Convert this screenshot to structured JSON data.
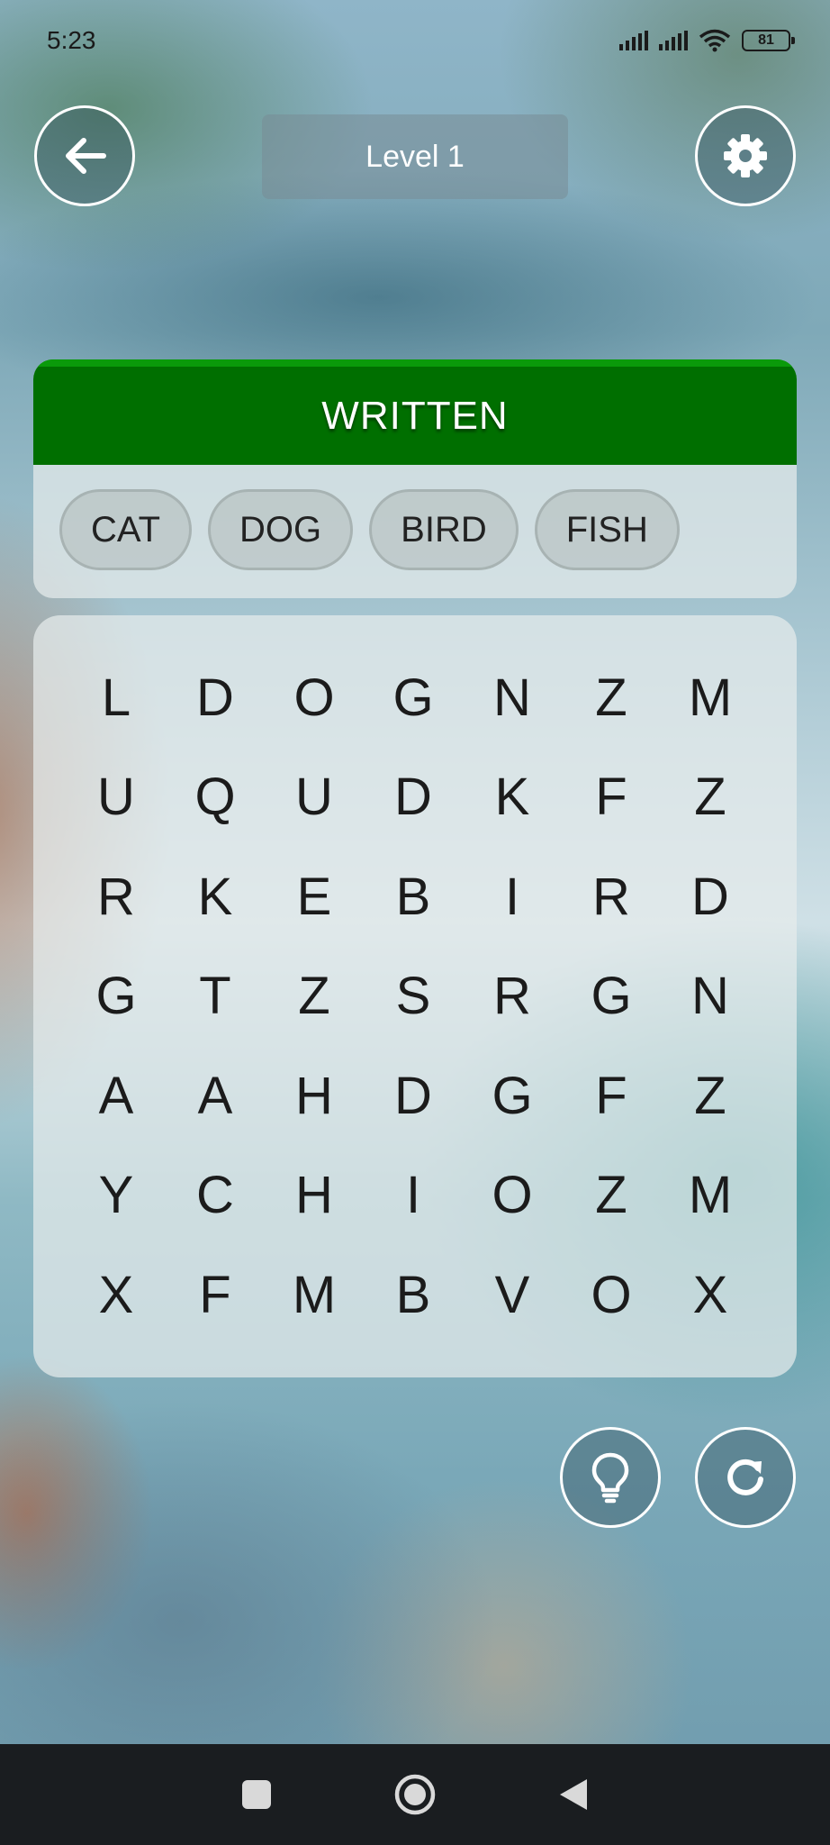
{
  "status_bar": {
    "time": "5:23",
    "battery": "81"
  },
  "header": {
    "level_label": "Level 1"
  },
  "words_panel": {
    "title": "WRITTEN",
    "words": [
      "CAT",
      "DOG",
      "BIRD",
      "FISH"
    ]
  },
  "grid": {
    "rows": [
      [
        "L",
        "D",
        "O",
        "G",
        "N",
        "Z",
        "M"
      ],
      [
        "U",
        "Q",
        "U",
        "D",
        "K",
        "F",
        "Z"
      ],
      [
        "R",
        "K",
        "E",
        "B",
        "I",
        "R",
        "D"
      ],
      [
        "G",
        "T",
        "Z",
        "S",
        "R",
        "G",
        "N"
      ],
      [
        "A",
        "A",
        "H",
        "D",
        "G",
        "F",
        "Z"
      ],
      [
        "Y",
        "C",
        "H",
        "I",
        "O",
        "Z",
        "M"
      ],
      [
        "X",
        "F",
        "M",
        "B",
        "V",
        "O",
        "X"
      ]
    ]
  },
  "icons": {
    "back": "arrow-left-icon",
    "settings": "gear-icon",
    "hint": "lightbulb-icon",
    "restart": "refresh-icon"
  },
  "colors": {
    "header_green": "#006f00",
    "button_border": "#ffffff"
  }
}
